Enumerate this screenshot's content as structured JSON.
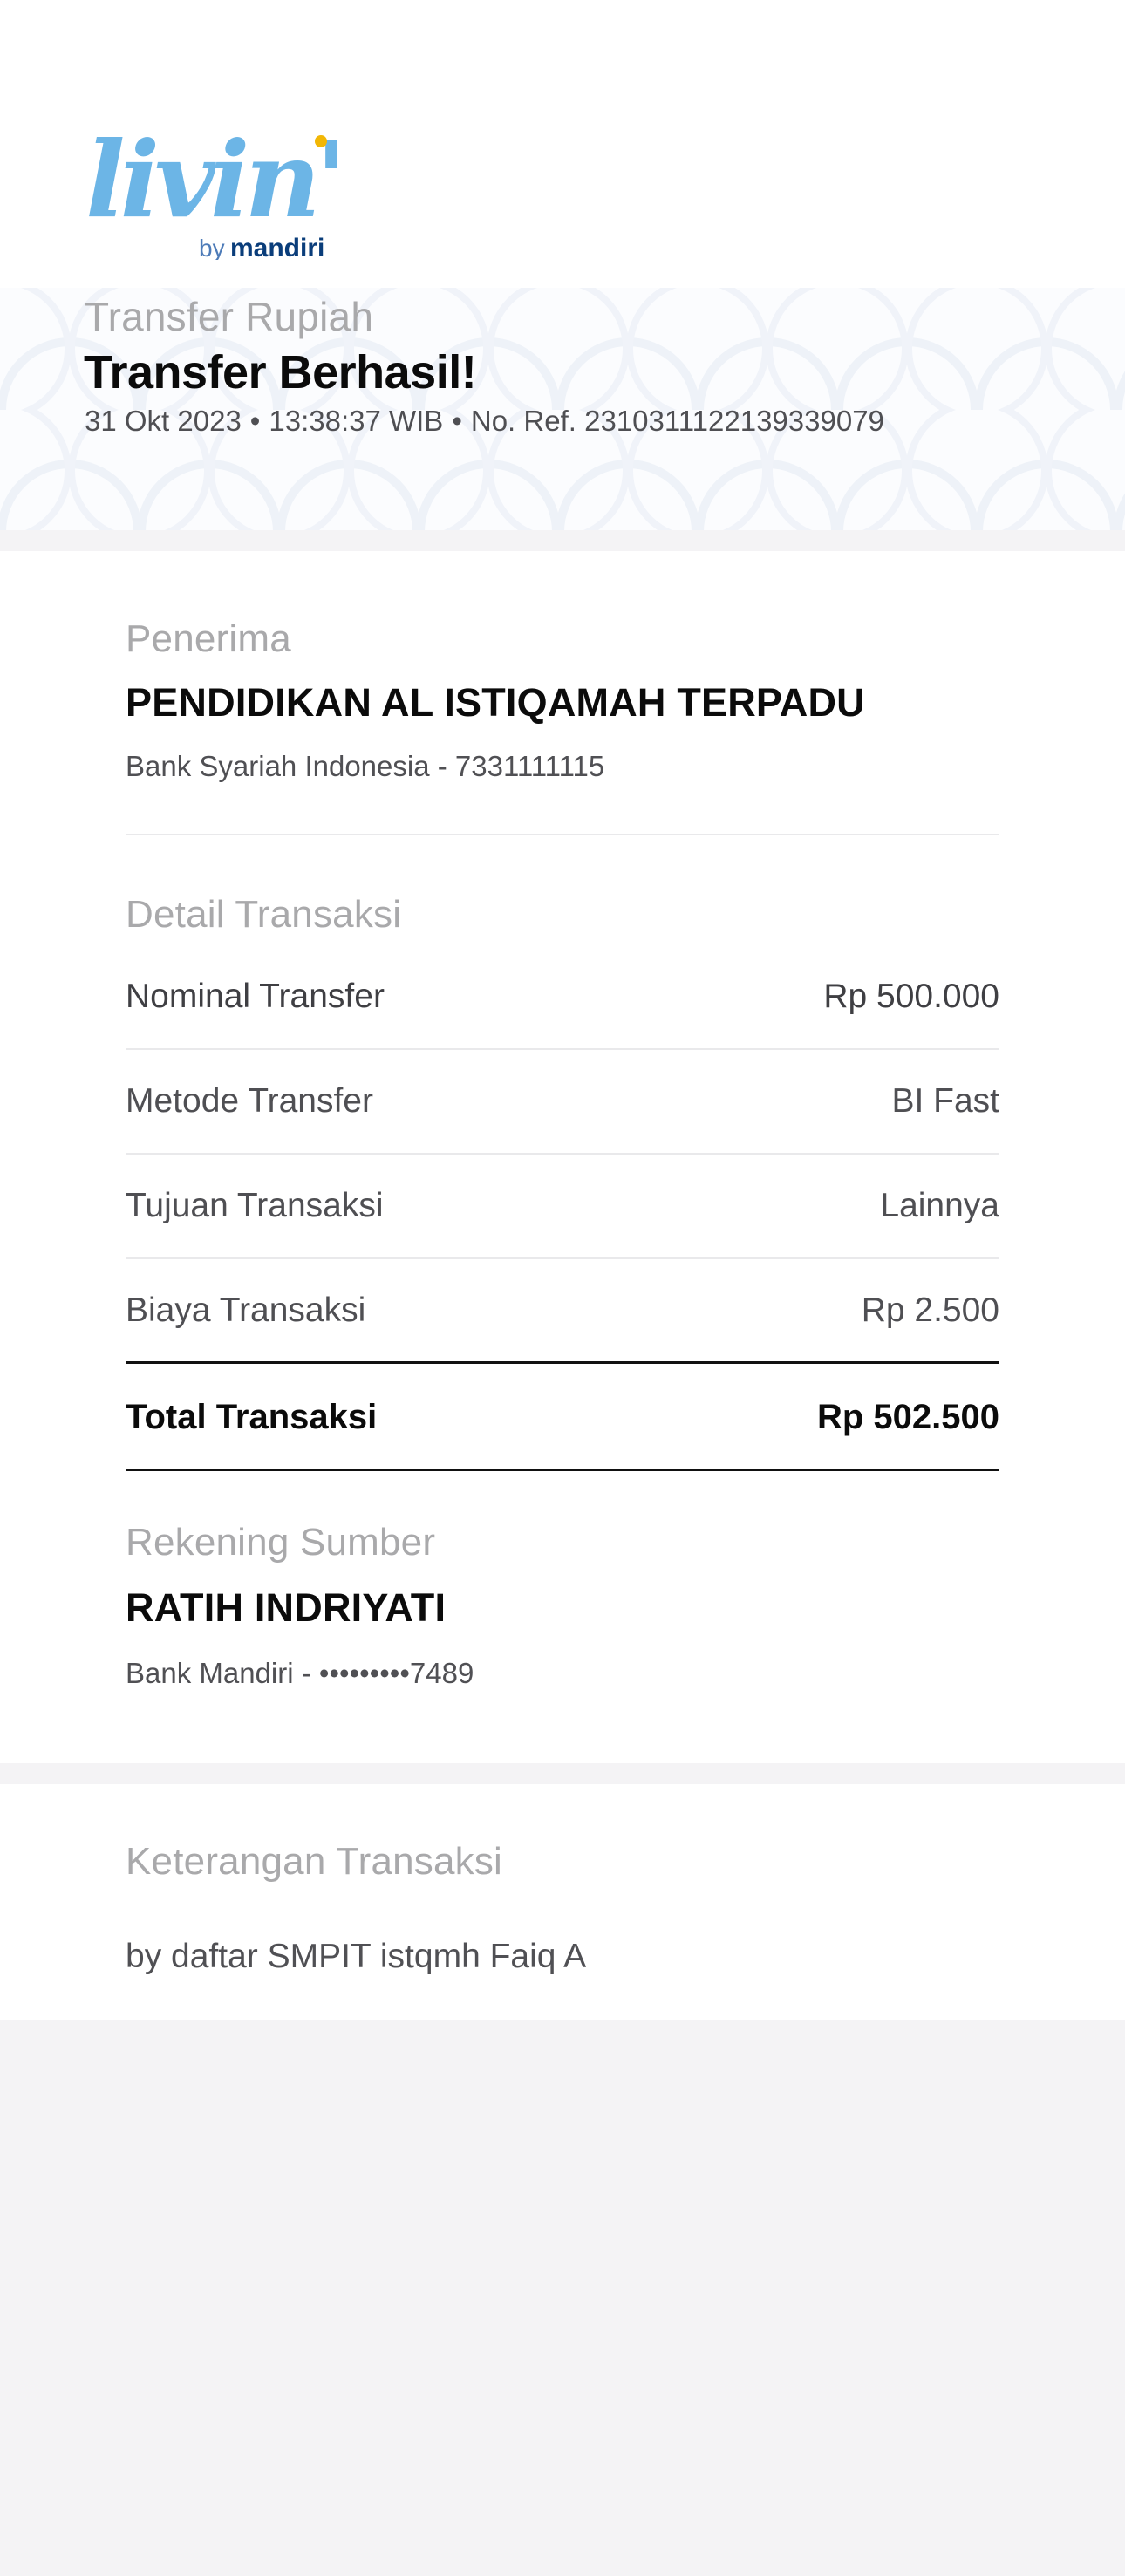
{
  "header": {
    "logo": {
      "main_text": "livin'",
      "sub_prefix": "by",
      "sub_brand": "mandiri",
      "colors": {
        "main": "#6cb5e6",
        "accent": "#f2b705",
        "brand": "#0a3d7a"
      }
    },
    "subtitle": "Transfer Rupiah",
    "title": "Transfer Berhasil!",
    "date": "31 Okt 2023",
    "time": "13:38:37 WIB",
    "reference": "No. Ref. 2310311122139339079",
    "separator": "•"
  },
  "recipient": {
    "label": "Penerima",
    "name": "PENDIDIKAN AL ISTIQAMAH TERPADU",
    "bank_account": "Bank Syariah Indonesia - 7331111115"
  },
  "details": {
    "label": "Detail Transaksi",
    "rows": [
      {
        "label": "Nominal Transfer",
        "value": "Rp 500.000"
      },
      {
        "label": "Metode Transfer",
        "value": "BI Fast"
      },
      {
        "label": "Tujuan Transaksi",
        "value": "Lainnya"
      },
      {
        "label": "Biaya Transaksi",
        "value": "Rp 2.500"
      }
    ],
    "total": {
      "label": "Total Transaksi",
      "value": "Rp 502.500"
    }
  },
  "source": {
    "label": "Rekening Sumber",
    "name": "RATIH INDRIYATI",
    "bank_account": "Bank Mandiri - •••••••••7489"
  },
  "note": {
    "label": "Keterangan Transaksi",
    "text": "by daftar SMPIT istqmh Faiq A"
  }
}
